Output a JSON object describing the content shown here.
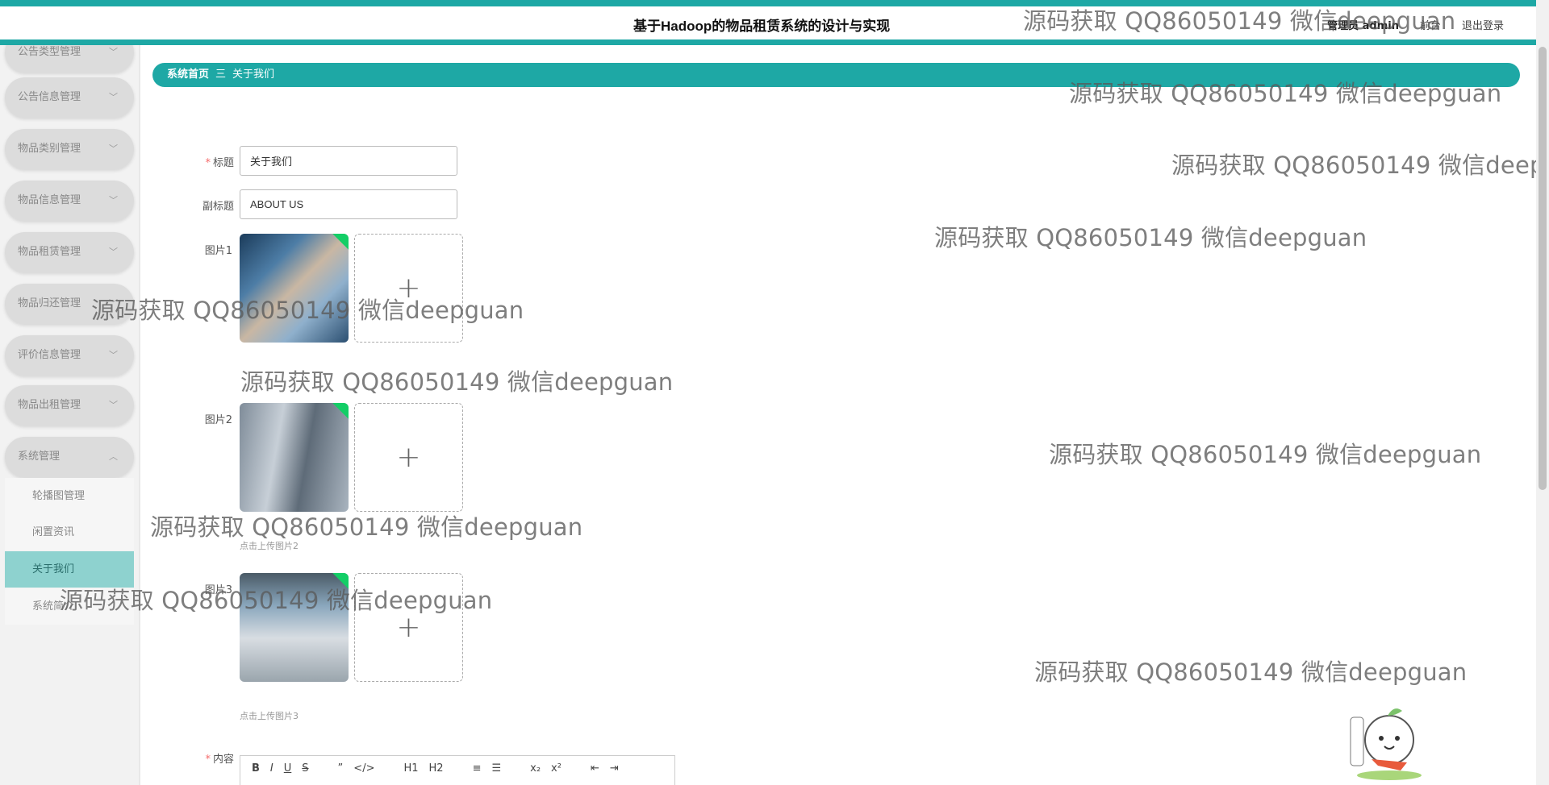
{
  "header": {
    "title": "基于Hadoop的物品租赁系统的设计与实现",
    "user_label": "管理员 admin",
    "link_front": "前台",
    "logout": "退出登录"
  },
  "sidebar": {
    "items": [
      {
        "label": "公告类型管理"
      },
      {
        "label": "公告信息管理"
      },
      {
        "label": "物品类别管理"
      },
      {
        "label": "物品信息管理"
      },
      {
        "label": "物品租赁管理"
      },
      {
        "label": "物品归还管理"
      },
      {
        "label": "评价信息管理"
      },
      {
        "label": "物品出租管理"
      },
      {
        "label": "系统管理"
      }
    ],
    "sub_items": [
      {
        "label": "轮播图管理"
      },
      {
        "label": "闲置资讯"
      },
      {
        "label": "关于我们"
      },
      {
        "label": "系统简介"
      }
    ]
  },
  "breadcrumb": {
    "home": "系统首页",
    "separator": "三",
    "current": "关于我们"
  },
  "form": {
    "title_label": "标题",
    "title_value": "关于我们",
    "subtitle_label": "副标题",
    "subtitle_value": "ABOUT US",
    "image1_label": "图片1",
    "image2_label": "图片2",
    "image3_label": "图片3",
    "image2_hint": "点击上传图片2",
    "image3_hint": "点击上传图片3",
    "content_label": "内容",
    "upload_plus": "+"
  },
  "editor": {
    "tools": [
      "B",
      "I",
      "U",
      "S",
      "”",
      "</>",
      "H1",
      "H2",
      "≡",
      "☰",
      "x₂",
      "x²",
      "⇤",
      "⇥"
    ]
  },
  "watermark": {
    "text": "源码获取 QQ86050149 微信deepguan"
  },
  "colors": {
    "accent": "#1ea8a5",
    "active_sub": "#8ed2cf"
  }
}
